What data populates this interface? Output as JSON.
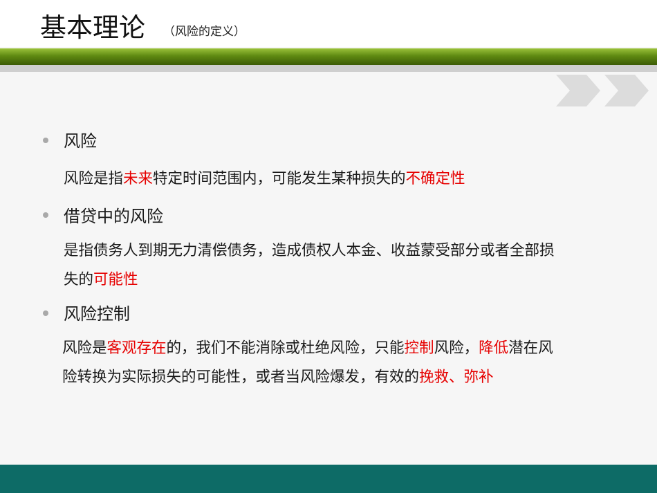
{
  "header": {
    "title": "基本理论",
    "subtitle": "（风险的定义）"
  },
  "sections": [
    {
      "heading": "风险",
      "lines": [
        [
          {
            "text": "风险是指"
          },
          {
            "text": "未来",
            "highlight": true
          },
          {
            "text": "特定时间范围内，可能发生某种损失的"
          },
          {
            "text": "不确定性",
            "highlight": true
          }
        ]
      ]
    },
    {
      "heading": "借贷中的风险",
      "lines": [
        [
          {
            "text": "是指债务人到期无力清偿债务，造成债权人本金、收益蒙受部分或者全部损"
          }
        ],
        [
          {
            "text": "失的"
          },
          {
            "text": "可能性",
            "highlight": true
          }
        ]
      ]
    },
    {
      "heading": "风险控制",
      "lines": [
        [
          {
            "text": "风险是"
          },
          {
            "text": "客观存在",
            "highlight": true
          },
          {
            "text": "的，我们不能消除或杜绝风险，只能"
          },
          {
            "text": "控制",
            "highlight": true
          },
          {
            "text": "风险，"
          },
          {
            "text": "降低",
            "highlight": true
          },
          {
            "text": "潜在风"
          }
        ],
        [
          {
            "text": "险转换为实际损失的可能性，或者当风险爆发，有效的"
          },
          {
            "text": "挽救、弥补",
            "highlight": true
          }
        ]
      ]
    }
  ],
  "colors": {
    "highlight": "#e60000",
    "header_bar": "#5f8a12",
    "footer_bar": "#0d6b66",
    "chevron": "#dcdcdc",
    "bullet": "#a9a9a9"
  },
  "icons": {
    "decoration": "double-chevron-right-icon"
  }
}
